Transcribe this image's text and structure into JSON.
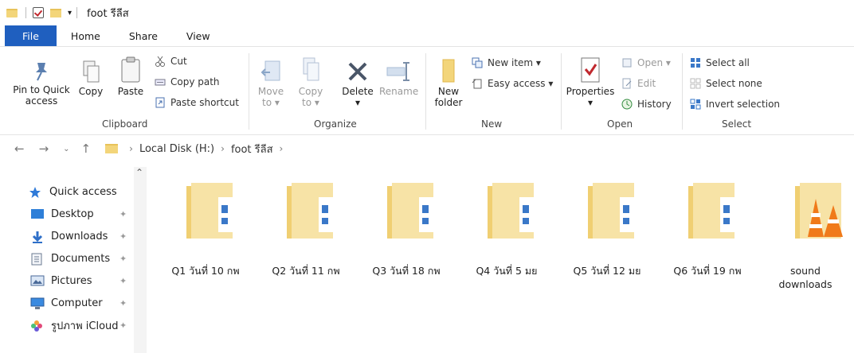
{
  "titlebar": {
    "title": "foot รีลีส",
    "dropdown": "▾"
  },
  "tabs": [
    {
      "label": "File"
    },
    {
      "label": "Home"
    },
    {
      "label": "Share"
    },
    {
      "label": "View"
    }
  ],
  "ribbon": {
    "clipboard": {
      "pin": "Pin to Quick\naccess",
      "copy": "Copy",
      "paste": "Paste",
      "cut": "Cut",
      "copy_path": "Copy path",
      "paste_shortcut": "Paste shortcut",
      "group": "Clipboard"
    },
    "organize": {
      "move": "Move\nto ▾",
      "copy": "Copy\nto ▾",
      "delete": "Delete\n▾",
      "rename": "Rename",
      "group": "Organize"
    },
    "new": {
      "new_folder": "New\nfolder",
      "new_item": "New item ▾",
      "easy_access": "Easy access ▾",
      "group": "New"
    },
    "open": {
      "properties": "Properties\n▾",
      "open": "Open ▾",
      "edit": "Edit",
      "history": "History",
      "group": "Open"
    },
    "select": {
      "select_all": "Select all",
      "select_none": "Select none",
      "invert": "Invert selection",
      "group": "Select"
    }
  },
  "address": {
    "crumbs": [
      "Local Disk (H:)",
      "foot รีลีส"
    ],
    "sep": "›"
  },
  "sidebar": {
    "items": [
      {
        "label": "Quick access",
        "icon": "star-icon"
      },
      {
        "label": "Desktop",
        "icon": "desktop-icon"
      },
      {
        "label": "Downloads",
        "icon": "download-icon"
      },
      {
        "label": "Documents",
        "icon": "documents-icon"
      },
      {
        "label": "Pictures",
        "icon": "pictures-icon"
      },
      {
        "label": "Computer",
        "icon": "computer-icon"
      },
      {
        "label": "รูปภาพ iCloud",
        "icon": "icloud-photos-icon"
      }
    ]
  },
  "files": [
    {
      "name": "Q1 วันที่ 10 กพ",
      "type": "folder"
    },
    {
      "name": "Q2 วันที่ 11 กพ",
      "type": "folder"
    },
    {
      "name": "Q3 วันที่ 18 กพ",
      "type": "folder"
    },
    {
      "name": "Q4 วันที่ 5 มย",
      "type": "folder"
    },
    {
      "name": "Q5 วันที่ 12 มย",
      "type": "folder"
    },
    {
      "name": "Q6 วันที่ 19 กพ",
      "type": "folder"
    },
    {
      "name": "sound\ndownloads",
      "type": "vlc-folder"
    }
  ],
  "colors": {
    "file_tab": "#1f5fbf",
    "folder": "#f3d57a",
    "accent": "#1f6fd0"
  }
}
